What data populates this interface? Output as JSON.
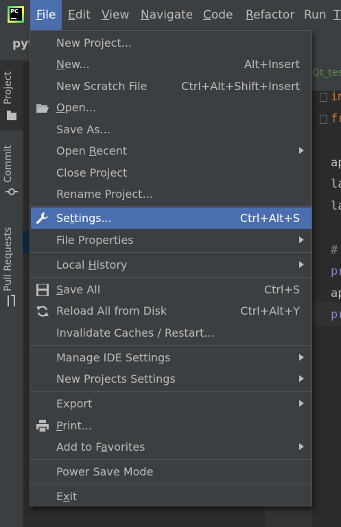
{
  "menubar": {
    "items": [
      {
        "pre": "",
        "mn": "F",
        "post": "ile"
      },
      {
        "pre": "",
        "mn": "E",
        "post": "dit"
      },
      {
        "pre": "",
        "mn": "V",
        "post": "iew"
      },
      {
        "pre": "",
        "mn": "N",
        "post": "avigate"
      },
      {
        "pre": "",
        "mn": "C",
        "post": "ode"
      },
      {
        "pre": "",
        "mn": "R",
        "post": "efactor"
      },
      {
        "pre": "",
        "mn": "",
        "post": "Run"
      },
      {
        "pre": "",
        "mn": "T",
        "post": ""
      }
    ]
  },
  "navbar": {
    "project": "pyt"
  },
  "toolwindows": {
    "project": "Project",
    "commit": "Commit",
    "pull_requests": "Pull Requests"
  },
  "editor": {
    "tab": "Qt_tes",
    "lines": [
      "im",
      "fr",
      "ap",
      "la",
      "la",
      "#",
      "pr",
      "ap",
      "pr"
    ]
  },
  "file_menu": {
    "new_project": "New Project...",
    "new": {
      "pre": "",
      "mn": "N",
      "post": "ew...",
      "shortcut": "Alt+Insert"
    },
    "new_scratch": {
      "label": "New Scratch File",
      "shortcut": "Ctrl+Alt+Shift+Insert"
    },
    "open": {
      "pre": "",
      "mn": "O",
      "post": "pen..."
    },
    "save_as": "Save As...",
    "open_recent": {
      "pre": "Open ",
      "mn": "R",
      "post": "ecent"
    },
    "close_project": "Close Project",
    "rename_project": "Rename Project...",
    "settings": {
      "pre": "Se",
      "mn": "t",
      "post": "tings...",
      "shortcut": "Ctrl+Alt+S"
    },
    "file_properties": "File Properties",
    "local_history": {
      "pre": "Local ",
      "mn": "H",
      "post": "istory"
    },
    "save_all": {
      "pre": "",
      "mn": "S",
      "post": "ave All",
      "shortcut": "Ctrl+S"
    },
    "reload": {
      "label": "Reload All from Disk",
      "shortcut": "Ctrl+Alt+Y"
    },
    "invalidate": "Invalidate Caches / Restart...",
    "manage_ide": "Manage IDE Settings",
    "new_projects_settings": "New Projects Settings",
    "export": "Export",
    "print": {
      "pre": "",
      "mn": "P",
      "post": "rint..."
    },
    "add_favorites": {
      "pre": "Add to F",
      "mn": "a",
      "post": "vorites"
    },
    "power_save": "Power Save Mode",
    "exit": {
      "pre": "E",
      "mn": "x",
      "post": "it"
    }
  },
  "colors": {
    "menu_bg": "#3c3f41",
    "selection": "#4b6eaf",
    "text": "#bbbbbb",
    "separator": "#555555"
  },
  "icons": [
    "pycharm-logo-icon",
    "folder-open-icon",
    "wrench-icon",
    "floppy-disk-icon",
    "reload-icon",
    "printer-icon",
    "folder-icon",
    "commit-icon",
    "pull-requests-icon"
  ]
}
